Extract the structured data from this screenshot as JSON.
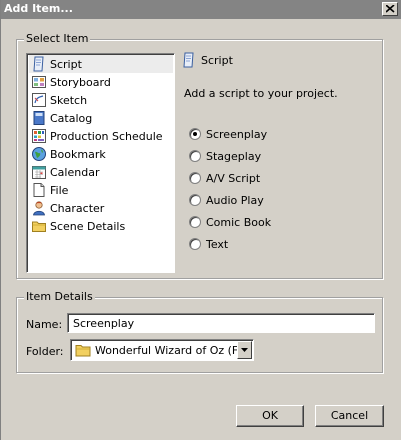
{
  "window": {
    "title": "Add Item...",
    "close_icon": "close-x-icon"
  },
  "select_group": {
    "label": "Select Item",
    "items": [
      {
        "label": "Script",
        "icon": "script-page-icon",
        "selected": true
      },
      {
        "label": "Storyboard",
        "icon": "storyboard-icon",
        "selected": false
      },
      {
        "label": "Sketch",
        "icon": "sketch-icon",
        "selected": false
      },
      {
        "label": "Catalog",
        "icon": "catalog-book-icon",
        "selected": false
      },
      {
        "label": "Production Schedule",
        "icon": "schedule-grid-icon",
        "selected": false
      },
      {
        "label": "Bookmark",
        "icon": "bookmark-globe-icon",
        "selected": false
      },
      {
        "label": "Calendar",
        "icon": "calendar-icon",
        "selected": false
      },
      {
        "label": "File",
        "icon": "file-page-icon",
        "selected": false
      },
      {
        "label": "Character",
        "icon": "character-person-icon",
        "selected": false
      },
      {
        "label": "Scene Details",
        "icon": "scene-folder-icon",
        "selected": false
      }
    ],
    "detail": {
      "title": "Script",
      "icon": "script-page-icon",
      "description": "Add a script to your project.",
      "options": [
        {
          "label": "Screenplay",
          "checked": true
        },
        {
          "label": "Stageplay",
          "checked": false
        },
        {
          "label": "A/V Script",
          "checked": false
        },
        {
          "label": "Audio Play",
          "checked": false
        },
        {
          "label": "Comic Book",
          "checked": false
        },
        {
          "label": "Text",
          "checked": false
        }
      ]
    }
  },
  "details_group": {
    "label": "Item Details",
    "name_label": "Name:",
    "name_value": "Screenplay",
    "folder_label": "Folder:",
    "folder_value": "Wonderful Wizard of Oz (Fi...",
    "folder_icon": "folder-icon",
    "dropdown_icon": "chevron-down-icon"
  },
  "buttons": {
    "ok": "OK",
    "cancel": "Cancel"
  }
}
